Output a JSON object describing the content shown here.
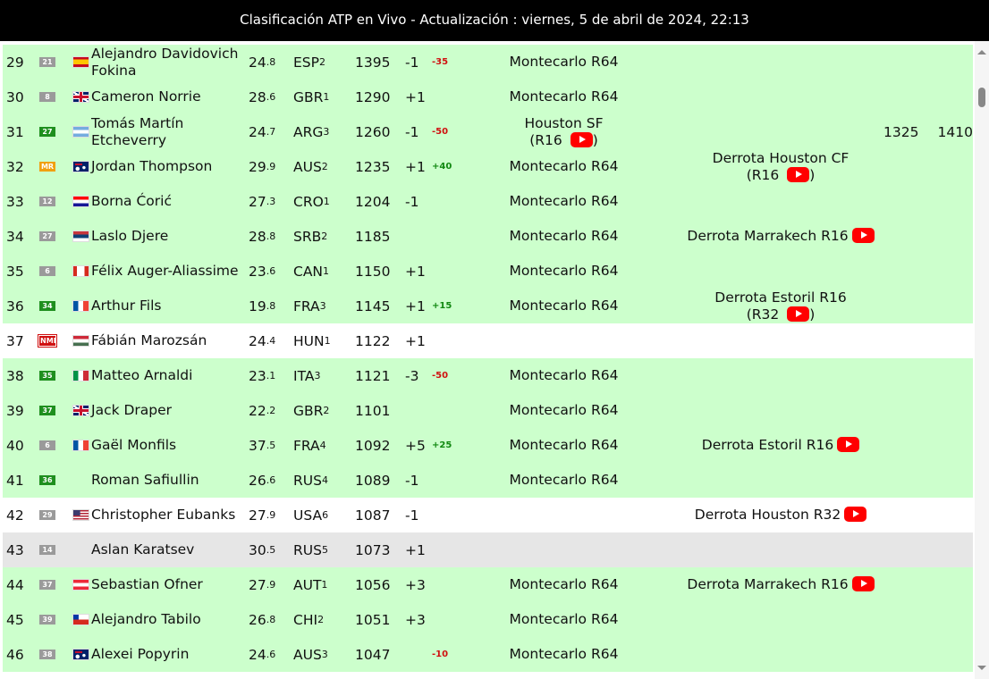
{
  "header": {
    "title": "Clasificación ATP en Vivo - Actualización : viernes, 5 de abril de 2024, 22:13"
  },
  "colors": {
    "row_green": "#ccffcc",
    "row_white": "#ffffff",
    "row_grey": "#e6e6e6",
    "youtube_red": "#ff0000"
  },
  "rows": [
    {
      "rank": "29",
      "badge": "21",
      "badge_style": "grey",
      "flag": "flag-spain-icon",
      "name": "Alejandro Davidovich Fokina",
      "age": "24",
      "age_dec": ".8",
      "country": "ESP",
      "country_n": "2",
      "points": "1395",
      "move": "-1",
      "delta": "-35",
      "delta_type": "neg",
      "current": "Montecarlo R64",
      "current_sub": "",
      "next": "",
      "next_sub": "",
      "pmin": "",
      "pmax": "",
      "bg": "green"
    },
    {
      "rank": "30",
      "badge": "8",
      "badge_style": "grey",
      "flag": "flag-uk-icon",
      "name": "Cameron Norrie",
      "age": "28",
      "age_dec": ".6",
      "country": "GBR",
      "country_n": "1",
      "points": "1290",
      "move": "+1",
      "delta": "",
      "delta_type": "",
      "current": "Montecarlo R64",
      "current_sub": "",
      "next": "",
      "next_sub": "",
      "pmin": "",
      "pmax": "",
      "bg": "green"
    },
    {
      "rank": "31",
      "badge": "27",
      "badge_style": "green",
      "flag": "flag-argentina-icon",
      "name": "Tomás Martín Etcheverry",
      "age": "24",
      "age_dec": ".7",
      "country": "ARG",
      "country_n": "3",
      "points": "1260",
      "move": "-1",
      "delta": "-50",
      "delta_type": "neg",
      "current": "Houston SF",
      "current_sub": "(R16",
      "next": "",
      "next_sub": "",
      "pmin": "1325",
      "pmax": "1410",
      "bg": "green"
    },
    {
      "rank": "32",
      "badge": "MR",
      "badge_style": "orange",
      "flag": "flag-australia-icon",
      "name": "Jordan Thompson",
      "age": "29",
      "age_dec": ".9",
      "country": "AUS",
      "country_n": "2",
      "points": "1235",
      "move": "+1",
      "delta": "+40",
      "delta_type": "pos",
      "current": "Montecarlo R64",
      "current_sub": "",
      "next": "Derrota Houston CF",
      "next_sub": "(R16",
      "pmin": "",
      "pmax": "",
      "bg": "green"
    },
    {
      "rank": "33",
      "badge": "12",
      "badge_style": "grey",
      "flag": "flag-croatia-icon",
      "name": "Borna Ćorić",
      "age": "27",
      "age_dec": ".3",
      "country": "CRO",
      "country_n": "1",
      "points": "1204",
      "move": "-1",
      "delta": "",
      "delta_type": "",
      "current": "Montecarlo R64",
      "current_sub": "",
      "next": "",
      "next_sub": "",
      "pmin": "",
      "pmax": "",
      "bg": "green"
    },
    {
      "rank": "34",
      "badge": "27",
      "badge_style": "grey",
      "flag": "flag-serbia-icon",
      "name": "Laslo Djere",
      "age": "28",
      "age_dec": ".8",
      "country": "SRB",
      "country_n": "2",
      "points": "1185",
      "move": "",
      "delta": "",
      "delta_type": "",
      "current": "Montecarlo R64",
      "current_sub": "",
      "next": "Derrota Marrakech R16",
      "next_sub": "",
      "pmin": "",
      "pmax": "",
      "bg": "green"
    },
    {
      "rank": "35",
      "badge": "6",
      "badge_style": "grey",
      "flag": "flag-canada-icon",
      "name": "Félix Auger-Aliassime",
      "age": "23",
      "age_dec": ".6",
      "country": "CAN",
      "country_n": "1",
      "points": "1150",
      "move": "+1",
      "delta": "",
      "delta_type": "",
      "current": "Montecarlo R64",
      "current_sub": "",
      "next": "",
      "next_sub": "",
      "pmin": "",
      "pmax": "",
      "bg": "green"
    },
    {
      "rank": "36",
      "badge": "34",
      "badge_style": "green",
      "flag": "flag-france-icon",
      "name": "Arthur Fils",
      "age": "19",
      "age_dec": ".8",
      "country": "FRA",
      "country_n": "3",
      "points": "1145",
      "move": "+1",
      "delta": "+15",
      "delta_type": "pos",
      "current": "Montecarlo R64",
      "current_sub": "",
      "next": "Derrota Estoril R16",
      "next_sub": "(R32",
      "pmin": "",
      "pmax": "",
      "bg": "green"
    },
    {
      "rank": "37",
      "badge": "NMR",
      "badge2": "(38)",
      "badge_style": "nmr",
      "flag": "flag-hungary-icon",
      "name": "Fábián Marozsán",
      "age": "24",
      "age_dec": ".4",
      "country": "HUN",
      "country_n": "1",
      "points": "1122",
      "move": "+1",
      "delta": "",
      "delta_type": "",
      "current": "",
      "current_sub": "",
      "next": "",
      "next_sub": "",
      "pmin": "",
      "pmax": "",
      "bg": "white"
    },
    {
      "rank": "38",
      "badge": "35",
      "badge_style": "green",
      "flag": "flag-italy-icon",
      "name": "Matteo Arnaldi",
      "age": "23",
      "age_dec": ".1",
      "country": "ITA",
      "country_n": "3",
      "points": "1121",
      "move": "-3",
      "delta": "-50",
      "delta_type": "neg",
      "current": "Montecarlo R64",
      "current_sub": "",
      "next": "",
      "next_sub": "",
      "pmin": "",
      "pmax": "",
      "bg": "green"
    },
    {
      "rank": "39",
      "badge": "37",
      "badge_style": "green",
      "flag": "flag-uk-icon",
      "name": "Jack Draper",
      "age": "22",
      "age_dec": ".2",
      "country": "GBR",
      "country_n": "2",
      "points": "1101",
      "move": "",
      "delta": "",
      "delta_type": "",
      "current": "Montecarlo R64",
      "current_sub": "",
      "next": "",
      "next_sub": "",
      "pmin": "",
      "pmax": "",
      "bg": "green"
    },
    {
      "rank": "40",
      "badge": "6",
      "badge_style": "grey",
      "flag": "flag-france-icon",
      "name": "Gaël Monfils",
      "age": "37",
      "age_dec": ".5",
      "country": "FRA",
      "country_n": "4",
      "points": "1092",
      "move": "+5",
      "delta": "+25",
      "delta_type": "pos",
      "current": "Montecarlo R64",
      "current_sub": "",
      "next": "Derrota Estoril R16",
      "next_sub": "",
      "pmin": "",
      "pmax": "",
      "bg": "green"
    },
    {
      "rank": "41",
      "badge": "36",
      "badge_style": "green",
      "flag": "",
      "name": "Roman Safiullin",
      "age": "26",
      "age_dec": ".6",
      "country": "RUS",
      "country_n": "4",
      "points": "1089",
      "move": "-1",
      "delta": "",
      "delta_type": "",
      "current": "Montecarlo R64",
      "current_sub": "",
      "next": "",
      "next_sub": "",
      "pmin": "",
      "pmax": "",
      "bg": "green"
    },
    {
      "rank": "42",
      "badge": "29",
      "badge_style": "grey",
      "flag": "flag-usa-icon",
      "name": "Christopher Eubanks",
      "age": "27",
      "age_dec": ".9",
      "country": "USA",
      "country_n": "6",
      "points": "1087",
      "move": "-1",
      "delta": "",
      "delta_type": "",
      "current": "",
      "current_sub": "",
      "next": "Derrota Houston R32",
      "next_sub": "",
      "pmin": "",
      "pmax": "",
      "bg": "white"
    },
    {
      "rank": "43",
      "badge": "14",
      "badge_style": "grey",
      "flag": "",
      "name": "Aslan Karatsev",
      "age": "30",
      "age_dec": ".5",
      "country": "RUS",
      "country_n": "5",
      "points": "1073",
      "move": "+1",
      "delta": "",
      "delta_type": "",
      "current": "",
      "current_sub": "",
      "next": "",
      "next_sub": "",
      "pmin": "",
      "pmax": "",
      "bg": "grey"
    },
    {
      "rank": "44",
      "badge": "37",
      "badge_style": "grey",
      "flag": "flag-austria-icon",
      "name": "Sebastian Ofner",
      "age": "27",
      "age_dec": ".9",
      "country": "AUT",
      "country_n": "1",
      "points": "1056",
      "move": "+3",
      "delta": "",
      "delta_type": "",
      "current": "Montecarlo R64",
      "current_sub": "",
      "next": "Derrota Marrakech R16",
      "next_sub": "",
      "pmin": "",
      "pmax": "",
      "bg": "green"
    },
    {
      "rank": "45",
      "badge": "39",
      "badge_style": "grey",
      "flag": "flag-chile-icon",
      "name": "Alejandro Tabilo",
      "age": "26",
      "age_dec": ".8",
      "country": "CHI",
      "country_n": "2",
      "points": "1051",
      "move": "+3",
      "delta": "",
      "delta_type": "",
      "current": "Montecarlo R64",
      "current_sub": "",
      "next": "",
      "next_sub": "",
      "pmin": "",
      "pmax": "",
      "bg": "green"
    },
    {
      "rank": "46",
      "badge": "38",
      "badge_style": "grey",
      "flag": "flag-australia-icon",
      "name": "Alexei Popyrin",
      "age": "24",
      "age_dec": ".6",
      "country": "AUS",
      "country_n": "3",
      "points": "1047",
      "move": "",
      "delta": "-10",
      "delta_type": "neg",
      "current": "Montecarlo R64",
      "current_sub": "",
      "next": "",
      "next_sub": "",
      "pmin": "",
      "pmax": "",
      "bg": "green"
    }
  ]
}
